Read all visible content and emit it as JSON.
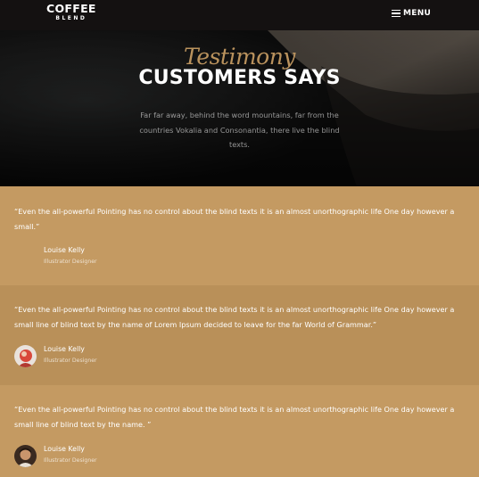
{
  "navbar": {
    "brand_top": "COFFEE",
    "brand_bottom": "BLEND",
    "menu_label": "MENU"
  },
  "hero": {
    "subheading": "Testimony",
    "heading": "CUSTOMERS SAYS",
    "text": "Far far away, behind the word mountains, far from the countries Vokalia and Consonantia, there live the blind texts."
  },
  "testimonials": [
    {
      "quote": "“Even the all-powerful Pointing has no control about the blind texts it is an almost unorthographic life One day however a small.”",
      "name": "Louise Kelly",
      "position": "Illustrator Designer",
      "avatar": "none"
    },
    {
      "quote": "“Even the all-powerful Pointing has no control about the blind texts it is an almost unorthographic life One day however a small line of blind text by the name of Lorem Ipsum decided to leave for the far World of Grammar.”",
      "name": "Louise Kelly",
      "position": "Illustrator Designer",
      "avatar": "person-photo"
    },
    {
      "quote": "“Even the all-powerful Pointing has no control about the blind texts it is an almost unorthographic life One day however a small line of blind text by the name. ”",
      "name": "Louise Kelly",
      "position": "Illustrator Designer",
      "avatar": "person-photo"
    }
  ],
  "colors": {
    "accent": "#c49a62",
    "accent_dark": "#b99059",
    "navbar_bg": "#141111"
  }
}
